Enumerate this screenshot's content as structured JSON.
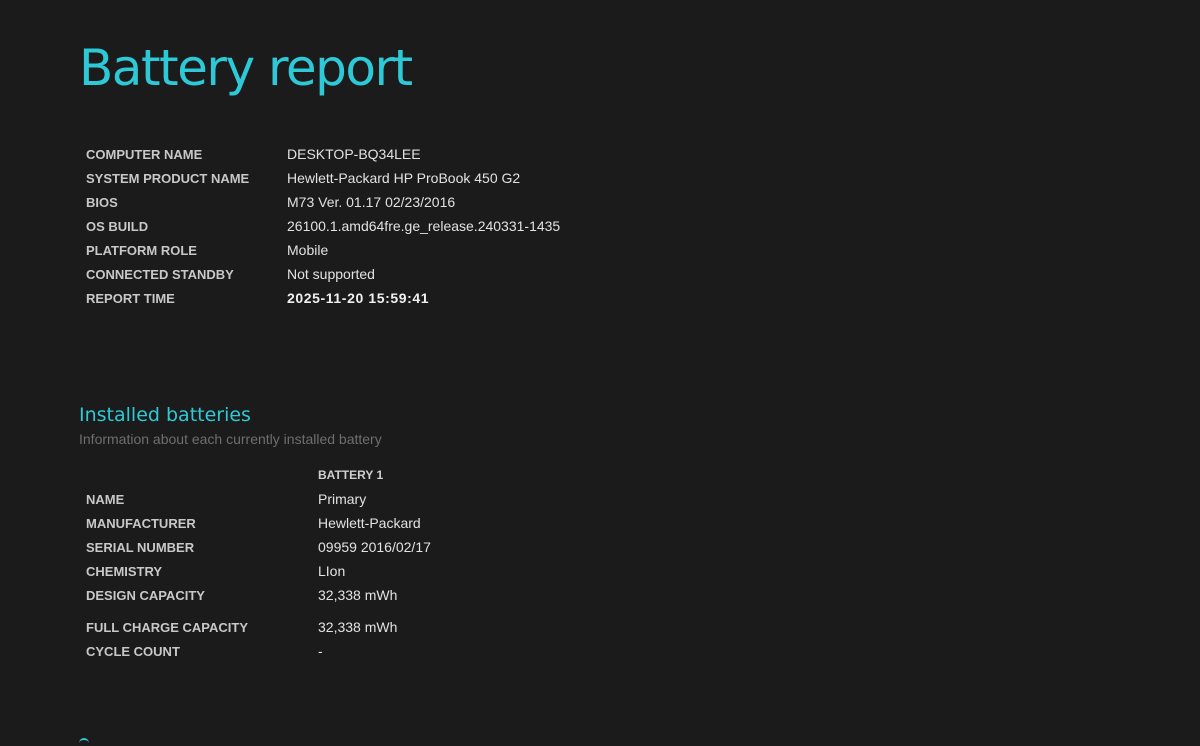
{
  "page": {
    "title": "Battery report"
  },
  "system_info": [
    {
      "label": "COMPUTER NAME",
      "value": "DESKTOP-BQ34LEE"
    },
    {
      "label": "SYSTEM PRODUCT NAME",
      "value": "Hewlett-Packard HP ProBook 450 G2"
    },
    {
      "label": "BIOS",
      "value": "M73 Ver. 01.17 02/23/2016"
    },
    {
      "label": "OS BUILD",
      "value": "26100.1.amd64fre.ge_release.240331-1435"
    },
    {
      "label": "PLATFORM ROLE",
      "value": "Mobile"
    },
    {
      "label": "CONNECTED STANDBY",
      "value": "Not supported"
    },
    {
      "label": "REPORT TIME",
      "value": "2025-11-20  15:59:41"
    }
  ],
  "installed_batteries": {
    "title": "Installed batteries",
    "subtitle": "Information about each currently installed battery",
    "column_header": "BATTERY 1",
    "rows": [
      {
        "label": "NAME",
        "value": "Primary"
      },
      {
        "label": "MANUFACTURER",
        "value": "Hewlett-Packard"
      },
      {
        "label": "SERIAL NUMBER",
        "value": "09959 2016/02/17"
      },
      {
        "label": "CHEMISTRY",
        "value": "LIon"
      },
      {
        "label": "DESIGN CAPACITY",
        "value": "32,338 mWh"
      },
      {
        "label": "FULL CHARGE CAPACITY",
        "value": "32,338 mWh"
      },
      {
        "label": "CYCLE COUNT",
        "value": "-"
      }
    ]
  },
  "colors": {
    "background": "#1b1b1b",
    "accent": "#2ec9d6",
    "text": "#e2e2e2",
    "muted": "#6e6e6e"
  }
}
